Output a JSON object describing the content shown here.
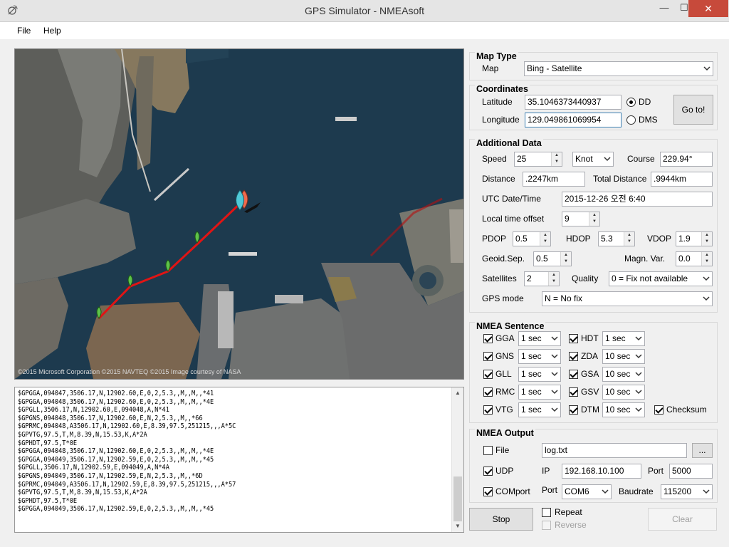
{
  "window": {
    "title": "GPS Simulator - NMEAsoft",
    "minimize": "—",
    "maximize": "☐",
    "close": "✕"
  },
  "menu": {
    "file": "File",
    "help": "Help"
  },
  "map_credit": "©2015 Microsoft Corporation  ©2015 NAVTEQ  ©2015 Image courtesy of NASA",
  "nmea_log": [
    "$GPGGA,094047,3506.17,N,12902.60,E,0,2,5.3,,M,,M,,*41",
    "$GPGGA,094048,3506.17,N,12902.60,E,0,2,5.3,,M,,M,,*4E",
    "$GPGLL,3506.17,N,12902.60,E,094048,A,N*41",
    "$GPGNS,094048,3506.17,N,12902.60,E,N,2,5.3,,M,,*66",
    "$GPRMC,094048,A3506.17,N,12902.60,E,8.39,97.5,251215,,,A*5C",
    "$GPVTG,97.5,T,M,8.39,N,15.53,K,A*2A",
    "$GPHDT,97.5,T*0E",
    "$GPGGA,094048,3506.17,N,12902.60,E,0,2,5.3,,M,,M,,*4E",
    "$GPGGA,094049,3506.17,N,12902.59,E,0,2,5.3,,M,,M,,*45",
    "$GPGLL,3506.17,N,12902.59,E,094049,A,N*4A",
    "$GPGNS,094049,3506.17,N,12902.59,E,N,2,5.3,,M,,*6D",
    "$GPRMC,094049,A3506.17,N,12902.59,E,8.39,97.5,251215,,,A*57",
    "$GPVTG,97.5,T,M,8.39,N,15.53,K,A*2A",
    "$GPHDT,97.5,T*0E",
    "$GPGGA,094049,3506.17,N,12902.59,E,0,2,5.3,,M,,M,,*45"
  ],
  "map_type": {
    "title": "Map Type",
    "label": "Map",
    "value": "Bing - Satellite"
  },
  "coordinates": {
    "title": "Coordinates",
    "latitude_label": "Latitude",
    "latitude": "35.1046373440937",
    "longitude_label": "Longitude",
    "longitude": "129.049861069954",
    "dd_label": "DD",
    "dms_label": "DMS",
    "goto_label": "Go to!"
  },
  "additional": {
    "title": "Additional Data",
    "speed_label": "Speed",
    "speed": "25",
    "speed_unit": "Knot",
    "course_label": "Course",
    "course": "229.94°",
    "distance_label": "Distance",
    "distance": ".2247km",
    "total_distance_label": "Total Distance",
    "total_distance": ".9944km",
    "utc_label": "UTC Date/Time",
    "utc": "2015-12-26  오전 6:40",
    "offset_label": "Local time offset",
    "offset": "9",
    "pdop_label": "PDOP",
    "pdop": "0.5",
    "hdop_label": "HDOP",
    "hdop": "5.3",
    "vdop_label": "VDOP",
    "vdop": "1.9",
    "geoid_label": "Geoid.Sep.",
    "geoid": "0.5",
    "magn_label": "Magn. Var.",
    "magn": "0.0",
    "satellites_label": "Satellites",
    "satellites": "2",
    "quality_label": "Quality",
    "quality": "0 = Fix not available",
    "gps_mode_label": "GPS mode",
    "gps_mode": "N = No fix"
  },
  "nmea_sentence": {
    "title": "NMEA Sentence",
    "gga_label": "GGA",
    "gga": "1 sec",
    "gns_label": "GNS",
    "gns": "1 sec",
    "gll_label": "GLL",
    "gll": "1 sec",
    "rmc_label": "RMC",
    "rmc": "1 sec",
    "vtg_label": "VTG",
    "vtg": "1 sec",
    "hdt_label": "HDT",
    "hdt": "1 sec",
    "zda_label": "ZDA",
    "zda": "10 sec",
    "gsa_label": "GSA",
    "gsa": "10 sec",
    "gsv_label": "GSV",
    "gsv": "10 sec",
    "dtm_label": "DTM",
    "dtm": "10 sec",
    "checksum_label": "Checksum"
  },
  "nmea_output": {
    "title": "NMEA Output",
    "file_label": "File",
    "file_value": "log.txt",
    "browse_label": "...",
    "udp_label": "UDP",
    "ip_label": "IP",
    "ip": "192.168.10.100",
    "port_label": "Port",
    "udp_port": "5000",
    "com_label": "COMport",
    "com_port_label": "Port",
    "com_port": "COM6",
    "baud_label": "Baudrate",
    "baud": "115200"
  },
  "controls": {
    "stop": "Stop",
    "repeat": "Repeat",
    "reverse": "Reverse",
    "clear": "Clear"
  },
  "colors": {
    "route": "#e11414",
    "waypoint": "#5ec24a",
    "current_marker": "#4fc9d8",
    "prev_marker": "#f06a4d",
    "close_button": "#c74a3b"
  }
}
